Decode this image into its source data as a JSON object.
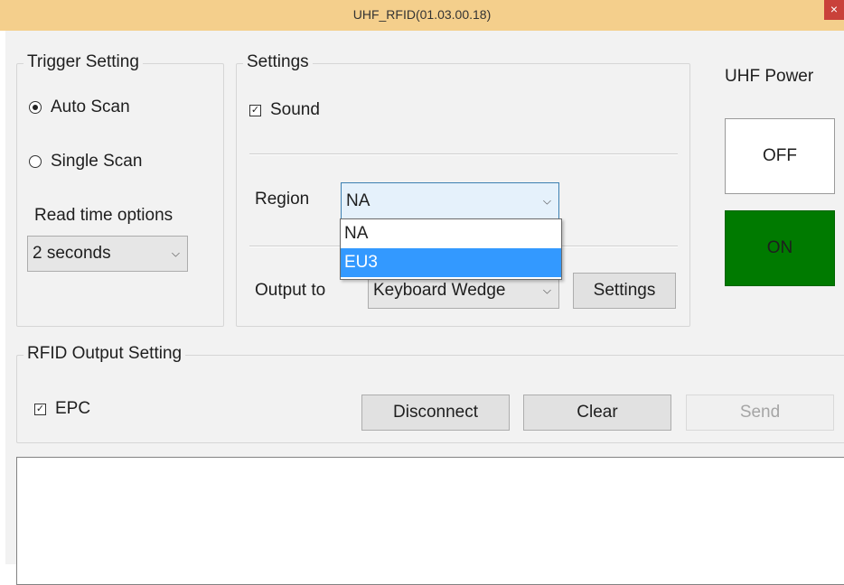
{
  "window": {
    "title": "UHF_RFID(01.03.00.18)",
    "close_glyph": "×"
  },
  "trigger": {
    "legend": "Trigger Setting",
    "auto_scan": "Auto Scan",
    "single_scan": "Single Scan",
    "read_time_label": "Read time options",
    "read_time_value": "2 seconds",
    "selected_mode": "Auto Scan"
  },
  "settings": {
    "legend": "Settings",
    "sound_label": "Sound",
    "sound_checked": true,
    "region_label": "Region",
    "region_value": "NA",
    "region_options": [
      "NA",
      "EU3"
    ],
    "region_highlighted": "EU3",
    "output_label": "Output to",
    "output_value": "Keyboard Wedge",
    "settings_button": "Settings"
  },
  "power": {
    "label": "UHF Power",
    "off_label": "OFF",
    "on_label": "ON",
    "on_color": "#007a00",
    "off_color": "#ffffff"
  },
  "rfid_output": {
    "legend": "RFID Output Setting",
    "epc_label": "EPC",
    "epc_checked": true,
    "disconnect_button": "Disconnect",
    "clear_button": "Clear",
    "send_button": "Send"
  },
  "icons": {
    "checkbox": "check-icon",
    "radio": "radio-dot-icon",
    "dropdown": "chevron-down-icon"
  },
  "colors": {
    "titlebar": "#f4cf8c",
    "selection": "#3399ff",
    "power_on": "#007a00"
  }
}
